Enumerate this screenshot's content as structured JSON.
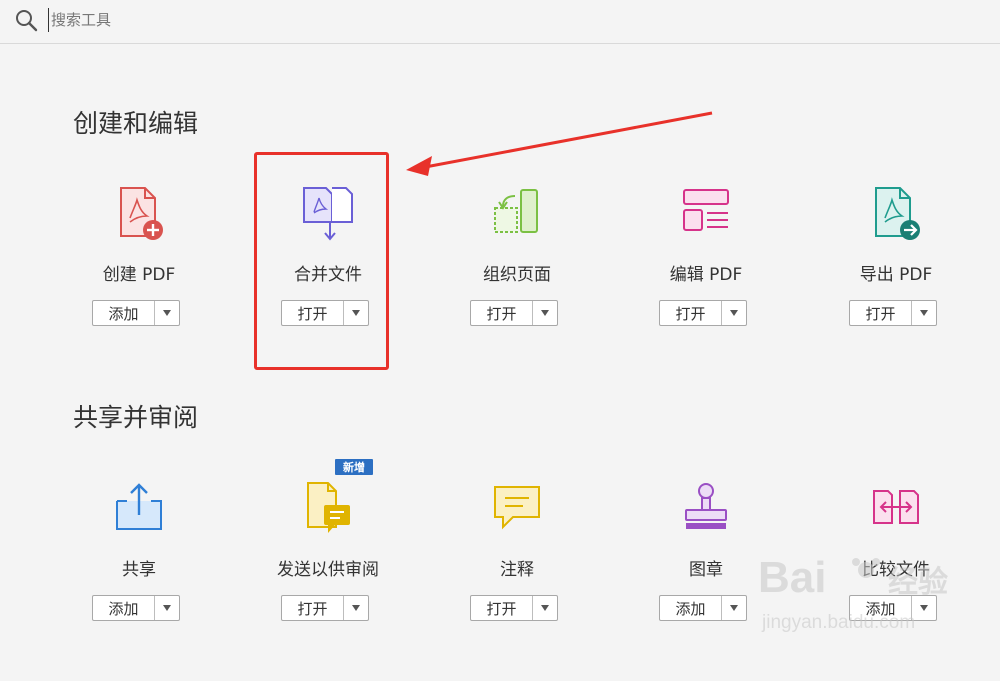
{
  "search": {
    "placeholder": "搜索工具"
  },
  "sections": [
    {
      "title": "创建和编辑"
    },
    {
      "title": "共享并审阅"
    }
  ],
  "tools": [
    {
      "label": "创建 PDF",
      "button": "添加",
      "icon": "create-pdf-icon",
      "color": "#d9534f"
    },
    {
      "label": "合并文件",
      "button": "打开",
      "icon": "combine-files-icon",
      "color": "#6a5fd6"
    },
    {
      "label": "组织页面",
      "button": "打开",
      "icon": "organize-pages-icon",
      "color": "#7bc043"
    },
    {
      "label": "编辑 PDF",
      "button": "打开",
      "icon": "edit-pdf-icon",
      "color": "#d6338a"
    },
    {
      "label": "导出 PDF",
      "button": "打开",
      "icon": "export-pdf-icon",
      "color": "#1f9c8e"
    },
    {
      "label": "共享",
      "button": "添加",
      "icon": "share-icon",
      "color": "#2f7fd6"
    },
    {
      "label": "发送以供审阅",
      "button": "打开",
      "icon": "send-review-icon",
      "color": "#e0b400"
    },
    {
      "label": "注释",
      "button": "打开",
      "icon": "comment-icon",
      "color": "#e0b400"
    },
    {
      "label": "图章",
      "button": "添加",
      "icon": "stamp-icon",
      "color": "#9a4fc4"
    },
    {
      "label": "比较文件",
      "button": "添加",
      "icon": "compare-files-icon",
      "color": "#d6338a"
    }
  ],
  "badge": {
    "text": "新增"
  },
  "watermark": {
    "brand": "Bai",
    "brand2": "经验",
    "url": "jingyan.baidu.com"
  }
}
